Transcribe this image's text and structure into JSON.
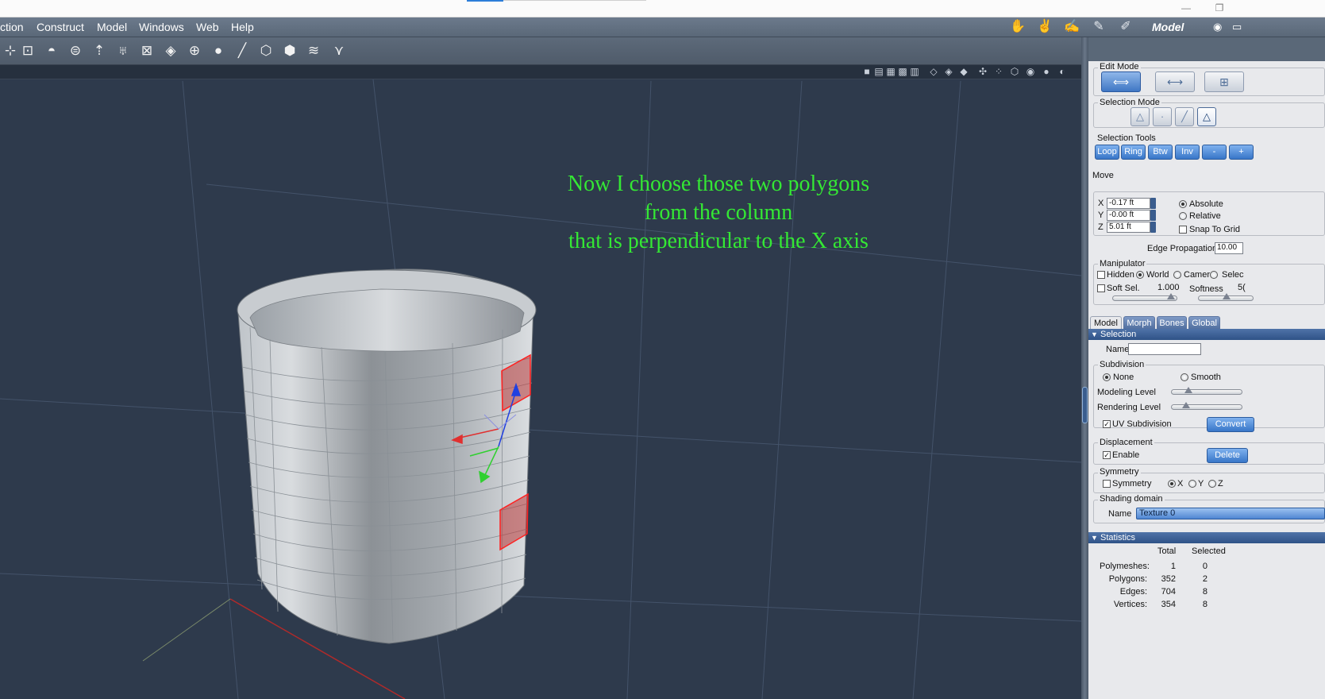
{
  "window": {
    "minimize_glyph": "—",
    "restore_glyph": "❐"
  },
  "menu": {
    "items": [
      "ction",
      "Construct",
      "Model",
      "Windows",
      "Web",
      "Help"
    ],
    "room_label": "Model",
    "room_tabs": [
      "pose-room-icon",
      "setup-room-icon",
      "shape-room-icon",
      "paint-room-icon",
      "uv-room-icon"
    ]
  },
  "toolbar": {
    "tools": [
      {
        "name": "select-tool-icon",
        "glyph": "⊹"
      },
      {
        "name": "transform-tool-icon",
        "glyph": "⊡"
      },
      {
        "name": "dome-primitive-icon",
        "glyph": "◓"
      },
      {
        "name": "disc-primitive-icon",
        "glyph": "⊜"
      },
      {
        "name": "extrude-tool-icon",
        "glyph": "⇡"
      },
      {
        "name": "lathe-tool-icon",
        "glyph": "♅"
      },
      {
        "name": "box-mapping-icon",
        "glyph": "⊠"
      },
      {
        "name": "cube-primitive-icon",
        "glyph": "◈"
      },
      {
        "name": "bag-tool-icon",
        "glyph": "⊕"
      },
      {
        "name": "sphere-tool-icon",
        "glyph": "●"
      },
      {
        "name": "pen-tool-icon",
        "glyph": "╱"
      },
      {
        "name": "deform-tool-icon",
        "glyph": "⬡"
      },
      {
        "name": "bend-tool-icon",
        "glyph": "⬢"
      },
      {
        "name": "twist-tool-icon",
        "glyph": "≋"
      },
      {
        "name": "taper-tool-icon",
        "glyph": "⋎"
      }
    ]
  },
  "viewport": {
    "layout_controls": [
      "■",
      "▤",
      "▦",
      "▩",
      "▥"
    ],
    "view_controls": [
      "◇",
      "◈",
      "◆",
      "✣",
      "⁘",
      "⬡",
      "◉",
      "●",
      "◐"
    ],
    "annotation_lines": [
      "Now I choose those two polygons",
      "from the column",
      "that is perpendicular to the X axis"
    ]
  },
  "panel": {
    "edit_mode": {
      "title": "Edit Mode",
      "modes": [
        {
          "name": "edit-mode-mesh-icon",
          "glyph": "⟺",
          "active": true
        },
        {
          "name": "edit-mode-uv-icon",
          "glyph": "⟷",
          "active": false
        },
        {
          "name": "edit-mode-weight-icon",
          "glyph": "⊞",
          "active": false
        }
      ]
    },
    "selection_mode": {
      "title": "Selection Mode",
      "modes": [
        {
          "name": "select-object-icon",
          "glyph": "△",
          "active": false
        },
        {
          "name": "select-vertex-icon",
          "glyph": "·",
          "active": false
        },
        {
          "name": "select-edge-icon",
          "glyph": "╱",
          "active": false
        },
        {
          "name": "select-polygon-icon",
          "glyph": "△",
          "active": true
        }
      ]
    },
    "selection_tools": {
      "title": "Selection Tools",
      "buttons": [
        "Loop",
        "Ring",
        "Btw",
        "Inv",
        "-",
        "+"
      ]
    },
    "move": {
      "title": "Move",
      "x_label": "X",
      "x_value": "-0.17 ft",
      "y_label": "Y",
      "y_value": "-0.00 ft",
      "z_label": "Z",
      "z_value": "5.01 ft",
      "absolute": "Absolute",
      "relative": "Relative",
      "snap_to_grid": "Snap To Grid",
      "edge_propagation_label": "Edge Propagation",
      "edge_propagation_value": "10.00"
    },
    "manipulator": {
      "title": "Manipulator",
      "hidden": "Hidden",
      "world": "World",
      "camera": "Camera",
      "select": "Selec",
      "soft_sel": "Soft Sel.",
      "soft_sel_value": "1.000",
      "softness": "Softness",
      "softness_value": "5("
    },
    "tabs": [
      "Model",
      "Morph",
      "Bones",
      "Global"
    ],
    "selection_section": {
      "title": "Selection",
      "name_label": "Name",
      "name_value": "",
      "subdivision_title": "Subdivision",
      "none": "None",
      "smooth": "Smooth",
      "modeling_level": "Modeling Level",
      "rendering_level": "Rendering Level",
      "uv_subdivision": "UV Subdivision",
      "convert_button": "Convert",
      "displacement_title": "Displacement",
      "enable": "Enable",
      "delete_button": "Delete",
      "symmetry_title": "Symmetry",
      "symmetry": "Symmetry",
      "sym_x": "X",
      "sym_y": "Y",
      "sym_z": "Z",
      "shading_title": "Shading domain",
      "shading_name_label": "Name",
      "shading_value": "Texture 0"
    },
    "statistics": {
      "title": "Statistics",
      "col_total": "Total",
      "col_selected": "Selected",
      "rows": [
        {
          "label": "Polymeshes:",
          "total": "1",
          "selected": "0"
        },
        {
          "label": "Polygons:",
          "total": "352",
          "selected": "2"
        },
        {
          "label": "Edges:",
          "total": "704",
          "selected": "8"
        },
        {
          "label": "Vertices:",
          "total": "354",
          "selected": "8"
        }
      ]
    }
  },
  "colors": {
    "annotation": "#34e834",
    "viewport_bg": "#2e3a4c",
    "selected_polygon": "#cc1f1f",
    "gizmo_x": "#e03030",
    "gizmo_y": "#30d030",
    "gizmo_z": "#2040e0"
  }
}
